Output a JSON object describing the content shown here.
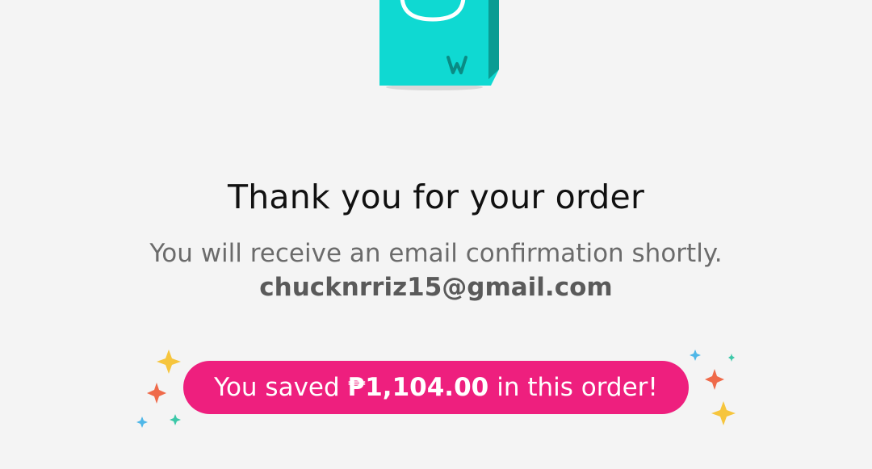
{
  "confirmation": {
    "title": "Thank you for your order",
    "message": "You will receive an email confirmation shortly.",
    "email": "chucknrriz15@gmail.com"
  },
  "savings": {
    "prefix": "You saved",
    "amount": "₱1,104.00",
    "suffix": "in this order!"
  },
  "colors": {
    "background": "#f4f4f4",
    "bag_teal": "#0fd9d2",
    "bag_dark_teal": "#0a9c93",
    "pill_pink": "#ee1f7e"
  },
  "icons": {
    "bag": "shopping-bag-icon",
    "sparkles": "sparkle-icon"
  }
}
